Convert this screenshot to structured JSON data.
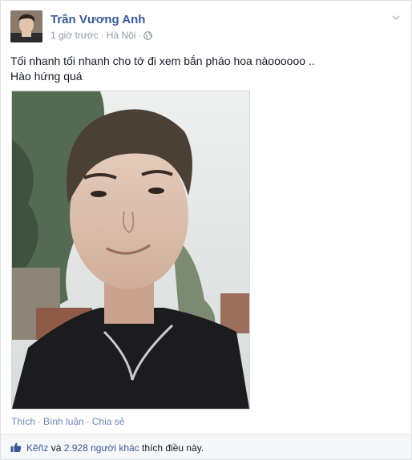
{
  "post": {
    "author": "Trần Vương Anh",
    "time": "1 giờ trước",
    "separator": "·",
    "location": "Hà Nội",
    "text_line1": "Tối nhanh tối nhanh cho tớ đi xem bắn pháo hoa nàoooooo ..",
    "text_line2": "Hào hứng quá"
  },
  "actions": {
    "like": "Thích",
    "comment": "Bình luận",
    "share": "Chia sẻ",
    "separator": "·"
  },
  "likes": {
    "first": "Kẽñz",
    "and": "và",
    "others": "2.928 người khác",
    "suffix": "thích điều này."
  },
  "colors": {
    "link_blue": "#3b5998",
    "action_blue": "#6d84b4",
    "meta_gray": "#9197a3"
  },
  "icons": [
    "globe-icon",
    "chevron-down-icon",
    "like-thumb-icon"
  ]
}
